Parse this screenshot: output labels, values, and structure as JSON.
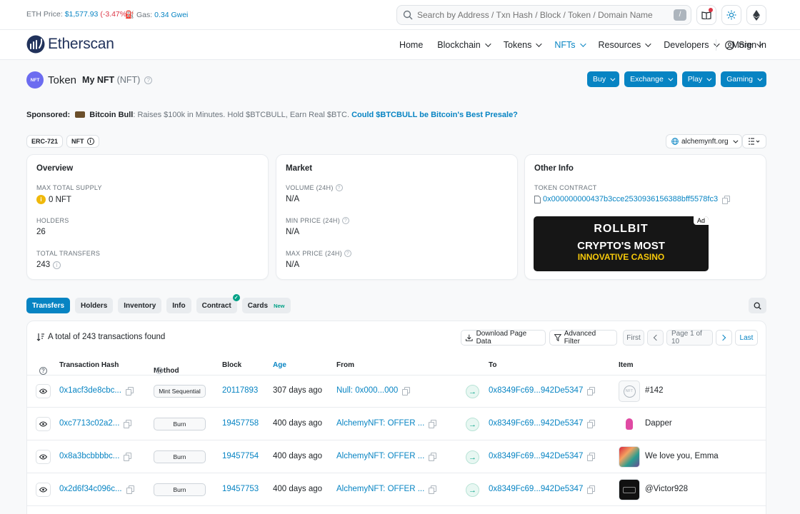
{
  "topbar": {
    "eth_price_label": "ETH Price:",
    "eth_price": "$1,577.93",
    "eth_change": "(-3.47%)",
    "gas_label": "Gas:",
    "gas_value": "0.34 Gwei",
    "search_placeholder": "Search by Address / Txn Hash / Block / Token / Domain Name",
    "search_shortcut": "/"
  },
  "nav": {
    "logo_text": "Etherscan",
    "items": [
      {
        "label": "Home"
      },
      {
        "label": "Blockchain"
      },
      {
        "label": "Tokens"
      },
      {
        "label": "NFTs"
      },
      {
        "label": "Resources"
      },
      {
        "label": "Developers"
      },
      {
        "label": "More"
      }
    ],
    "sign_in": "Sign In"
  },
  "token": {
    "icon_text": "NFT",
    "heading": "Token",
    "name": "My NFT",
    "symbol": "(NFT)",
    "buttons": [
      "Buy",
      "Exchange",
      "Play",
      "Gaming"
    ]
  },
  "sponsor": {
    "label": "Sponsored:",
    "brand": "Bitcoin Bull",
    "text": ": Raises $100k in Minutes. Hold $BTCBULL, Earn Real $BTC.",
    "cta": "Could $BTCBULL be Bitcoin's Best Presale?"
  },
  "badges": [
    "ERC-721",
    "NFT"
  ],
  "website": "alchemynft.org",
  "overview": {
    "title": "Overview",
    "max_supply_label": "MAX TOTAL SUPPLY",
    "max_supply": "0 NFT",
    "holders_label": "HOLDERS",
    "holders": "26",
    "transfers_label": "TOTAL TRANSFERS",
    "transfers": "243"
  },
  "market": {
    "title": "Market",
    "volume_label": "VOLUME (24H)",
    "volume": "N/A",
    "min_label": "MIN PRICE (24H)",
    "min": "N/A",
    "max_label": "MAX PRICE (24H)",
    "max": "N/A"
  },
  "other": {
    "title": "Other Info",
    "contract_label": "TOKEN CONTRACT",
    "contract": "0x000000000437b3cce2530936156388bff5578fc3",
    "ad_tag": "Ad",
    "ad_brand": "ROLLBIT",
    "ad_line1": "CRYPTO'S MOST",
    "ad_line2": "INNOVATIVE CASINO"
  },
  "tabs": [
    {
      "label": "Transfers",
      "active": true
    },
    {
      "label": "Holders"
    },
    {
      "label": "Inventory"
    },
    {
      "label": "Info"
    },
    {
      "label": "Contract"
    },
    {
      "label": "Cards",
      "tag": "New"
    }
  ],
  "table": {
    "total": "A total of 243 transactions found",
    "download": "Download Page Data",
    "filter": "Advanced Filter",
    "first": "First",
    "page": "Page 1 of 10",
    "last": "Last",
    "headers": {
      "hash": "Transaction Hash",
      "method": "Method",
      "block": "Block",
      "age": "Age",
      "from": "From",
      "to": "To",
      "item": "Item"
    },
    "rows": [
      {
        "hash": "0x1acf3de8cbc...",
        "method": "Mint Sequential",
        "block": "20117893",
        "age": "307 days ago",
        "from": "Null: 0x000...000",
        "to": "0x8349Fc69...942De5347",
        "item": "#142"
      },
      {
        "hash": "0xc7713c02a2...",
        "method": "Burn",
        "block": "19457758",
        "age": "400 days ago",
        "from": "AlchemyNFT: OFFER ...",
        "to": "0x8349Fc69...942De5347",
        "item": "Dapper"
      },
      {
        "hash": "0x8a3bcbbbbc...",
        "method": "Burn",
        "block": "19457754",
        "age": "400 days ago",
        "from": "AlchemyNFT: OFFER ...",
        "to": "0x8349Fc69...942De5347",
        "item": "We love you, Emma"
      },
      {
        "hash": "0x2d6f34c096c...",
        "method": "Burn",
        "block": "19457753",
        "age": "400 days ago",
        "from": "AlchemyNFT: OFFER ...",
        "to": "0x8349Fc69...942De5347",
        "item": "@Victor928"
      }
    ]
  },
  "colors": {
    "accent": "#0784c3",
    "negative": "#dc3545",
    "success": "#00a186"
  }
}
